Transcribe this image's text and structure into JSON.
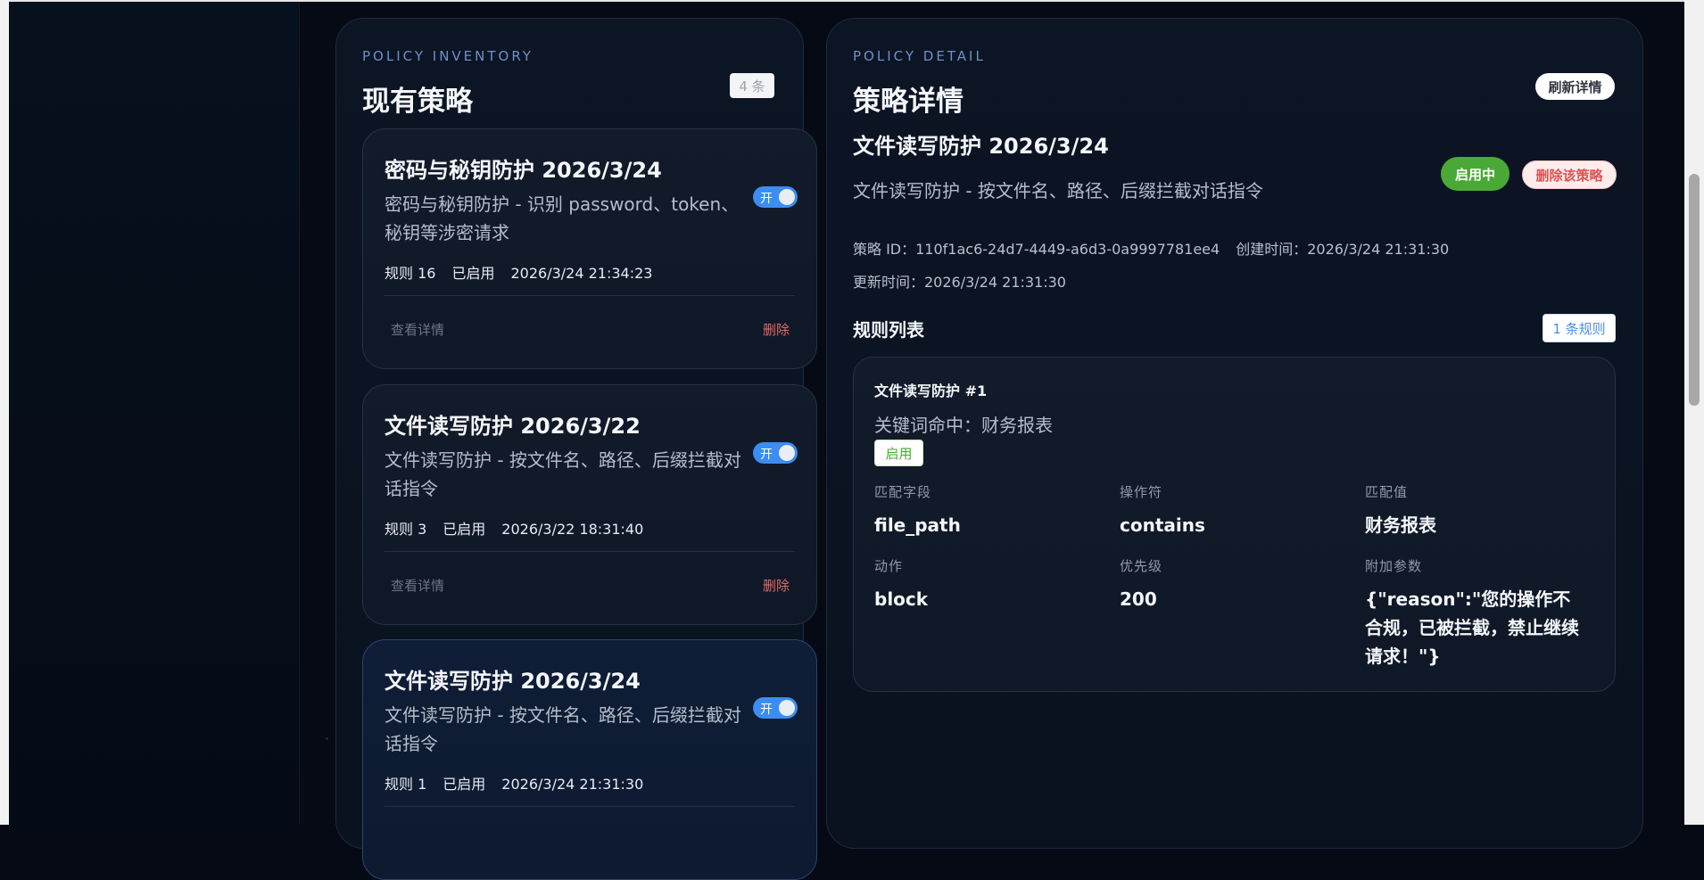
{
  "inventory": {
    "eyebrow": "POLICY INVENTORY",
    "title": "现有策略",
    "count": "4 条",
    "cards": [
      {
        "title": "密码与秘钥防护 2026/3/24",
        "desc": "密码与秘钥防护 - 识别 password、token、秘钥等涉密请求",
        "toggle": "开",
        "rules": "规则 16",
        "status": "已启用",
        "time": "2026/3/24 21:34:23",
        "view": "查看详情",
        "delete": "删除"
      },
      {
        "title": "文件读写防护 2026/3/22",
        "desc": "文件读写防护 - 按文件名、路径、后缀拦截对话指令",
        "toggle": "开",
        "rules": "规则 3",
        "status": "已启用",
        "time": "2026/3/22 18:31:40",
        "view": "查看详情",
        "delete": "删除"
      },
      {
        "title": "文件读写防护 2026/3/24",
        "desc": "文件读写防护 - 按文件名、路径、后缀拦截对话指令",
        "toggle": "开",
        "rules": "规则 1",
        "status": "已启用",
        "time": "2026/3/24 21:31:30"
      }
    ]
  },
  "detail": {
    "eyebrow": "POLICY DETAIL",
    "title": "策略详情",
    "refresh": "刷新详情",
    "name": "文件读写防护 2026/3/24",
    "desc": "文件读写防护 - 按文件名、路径、后缀拦截对话指令",
    "enabled": "启用中",
    "delete": "删除该策略",
    "policy_id": "策略 ID：110f1ac6-24d7-4449-a6d3-0a9997781ee4",
    "created": "创建时间：2026/3/24 21:31:30",
    "updated": "更新时间：2026/3/24 21:31:30",
    "rules_title": "规则列表",
    "rules_count": "1 条规则",
    "rule": {
      "title": "文件读写防护 #1",
      "summary": "关键词命中：财务报表",
      "status": "启用",
      "labels": {
        "field": "匹配字段",
        "operator": "操作符",
        "value": "匹配值",
        "action": "动作",
        "priority": "优先级",
        "params": "附加参数"
      },
      "values": {
        "field": "file_path",
        "operator": "contains",
        "value": "财务报表",
        "action": "block",
        "priority": "200",
        "params": "{\"reason\":\"您的操作不合规，已被拦截，禁止继续请求！\"}"
      }
    }
  },
  "colors": {
    "accent": "#3b8df2",
    "enabled": "#4aa936",
    "danger": "#e05252",
    "background": "#050a14"
  }
}
